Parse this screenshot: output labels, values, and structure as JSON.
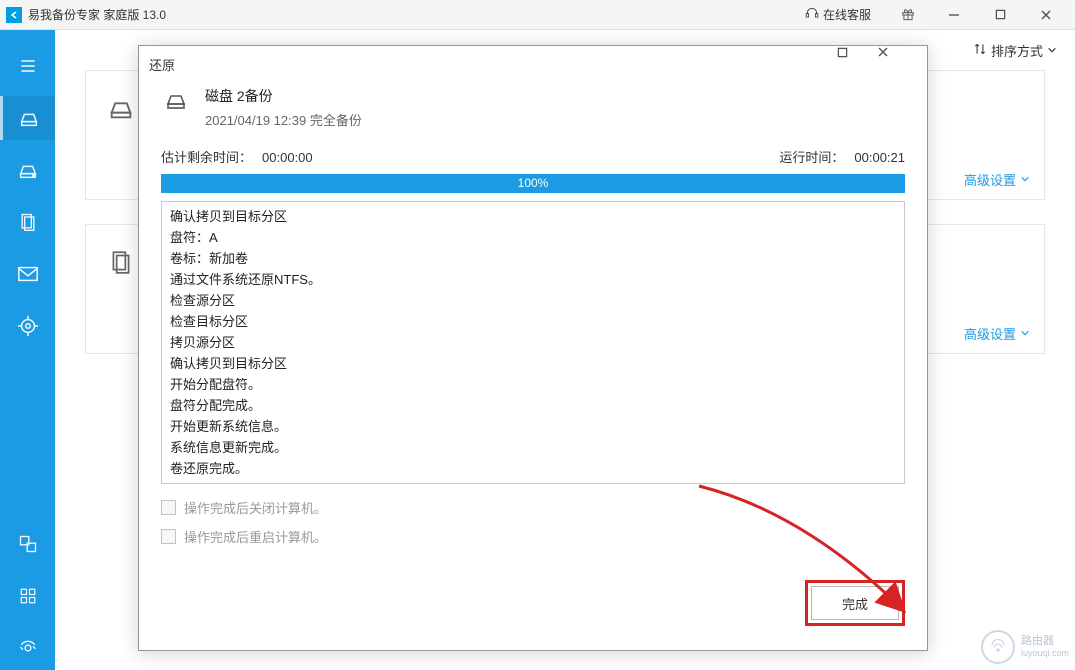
{
  "app": {
    "title": "易我备份专家 家庭版 13.0",
    "online_cs": "在线客服"
  },
  "toolbar": {
    "sort_label": "排序方式"
  },
  "tasks": [
    {
      "adv_label": "高级设置"
    },
    {
      "adv_label": "高级设置"
    }
  ],
  "dialog": {
    "title": "还原",
    "backup_name": "磁盘 2备份",
    "backup_sub": "2021/04/19 12:39 完全备份",
    "est_label": "估计剩余时间：",
    "est_value": "00:00:00",
    "run_label": "运行时间：",
    "run_value": "00:00:21",
    "progress_text": "100%",
    "log": [
      "确认拷贝到目标分区",
      "盘符：A",
      "卷标：新加卷",
      "通过文件系统还原NTFS。",
      "检查源分区",
      "检查目标分区",
      "拷贝源分区",
      "确认拷贝到目标分区",
      "开始分配盘符。",
      "盘符分配完成。",
      "开始更新系统信息。",
      "系统信息更新完成。",
      "卷还原完成。"
    ],
    "opt_shutdown": "操作完成后关闭计算机。",
    "opt_reboot": "操作完成后重启计算机。",
    "finish": "完成"
  },
  "watermark": "路由器\nluyouqi.com"
}
